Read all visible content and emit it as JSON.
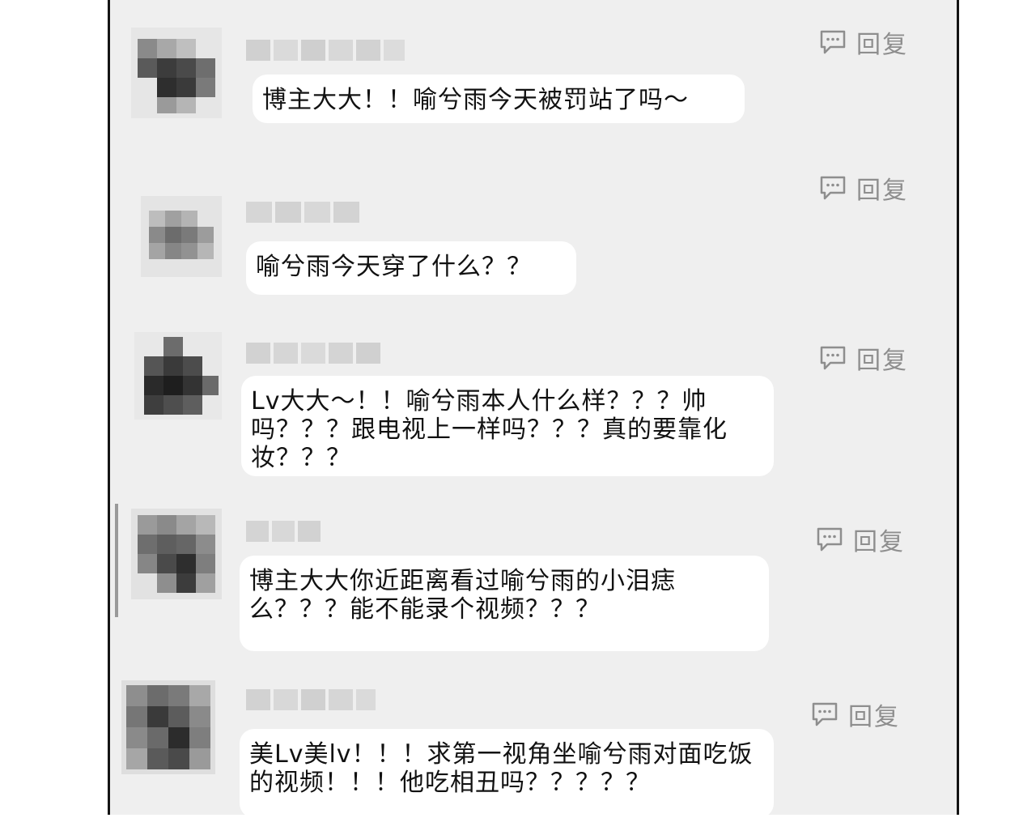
{
  "comments": [
    {
      "username": "",
      "text": "博主大大！！喻兮雨今天被罚站了吗～",
      "reply_label": "回复",
      "avatar_icon": "pixelated-avatar-icon"
    },
    {
      "username": "",
      "text": "喻兮雨今天穿了什么？？",
      "reply_label": "回复",
      "avatar_icon": "pixelated-avatar-icon"
    },
    {
      "username": "",
      "text": "Lv大大～！！喻兮雨本人什么样？？？帅吗？？？跟电视上一样吗？？？真的要靠化妆？？？",
      "reply_label": "回复",
      "avatar_icon": "pixelated-avatar-icon"
    },
    {
      "username": "",
      "text": "博主大大你近距离看过喻兮雨的小泪痣么？？？能不能录个视频？？？",
      "reply_label": "回复",
      "avatar_icon": "pixelated-avatar-icon"
    },
    {
      "username": "",
      "text": "美Lv美lv！！！求第一视角坐喻兮雨对面吃饭的视频！！！他吃相丑吗？？？？？",
      "reply_label": "回复",
      "avatar_icon": "pixelated-avatar-icon"
    }
  ],
  "icons": {
    "reply": "comment-bubble-icon"
  },
  "colors": {
    "panel_bg": "#efefef",
    "bubble_bg": "#ffffff",
    "reply_text": "#8e8e8e",
    "border": "#141414"
  }
}
